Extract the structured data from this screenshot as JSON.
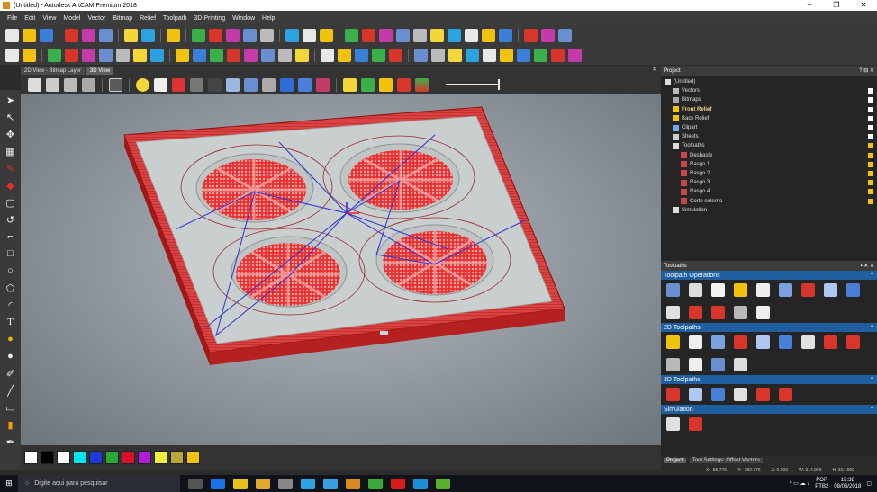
{
  "window": {
    "title": "(Untitled) - Autodesk ArtCAM Premium 2018",
    "controls": [
      "–",
      "❐",
      "✕"
    ]
  },
  "menu": [
    "File",
    "Edit",
    "View",
    "Model",
    "Vector",
    "Bitmap",
    "Relief",
    "Toolpath",
    "3D Printing",
    "Window",
    "Help"
  ],
  "colors": {
    "accent": "#1f5f9f",
    "toolpath_red": "#e02020",
    "toolpath_blue": "#2b34d4",
    "slab": "#c9cfcf",
    "frame": "#d42a2a"
  },
  "toolbar1_icons": [
    "new-icon",
    "open-icon",
    "save-icon",
    "sep",
    "cut-icon",
    "copy-icon",
    "paste-icon",
    "sep",
    "undo-icon",
    "redo-icon",
    "sep",
    "doc-icon",
    "sep",
    "crop-icon",
    "layers-icon",
    "grid-icon",
    "chart-icon",
    "wheel-icon",
    "sep",
    "eraser-icon",
    "diamond-icon",
    "nodes-icon",
    "sep",
    "folder-icon",
    "arrow-icon",
    "scissor-icon",
    "curve-icon",
    "star-icon",
    "green-diamond-icon",
    "stack-icon",
    "book-icon",
    "layer-stack-icon",
    "yellow-diamond-icon",
    "sep",
    "dots-icon",
    "grid-dots-icon",
    "wave-icon"
  ],
  "toolbar2_icons": [
    "search-icon",
    "flower-icon",
    "sep",
    "relief-blue-icon",
    "eraser-red-icon",
    "relief-1-icon",
    "relief-2-icon",
    "box-yellow-icon",
    "box-orange-icon",
    "box-ring-icon",
    "sep",
    "relief-3-icon",
    "relief-4-icon",
    "relief-5-icon",
    "relief-6-icon",
    "relief-7-icon",
    "relief-8-icon",
    "relief-9-icon",
    "relief-10-icon",
    "sep",
    "blue-1-icon",
    "blue-2-icon",
    "blue-3-icon",
    "bottle-icon",
    "layers-2-icon",
    "sep",
    "plus-green-icon",
    "cylinder-icon",
    "spiral-icon",
    "sweep-icon",
    "arch-icon",
    "magenta-icon",
    "ghost-1-icon",
    "ghost-2-icon",
    "ghost-3-icon",
    "target-icon"
  ],
  "view_tabs": [
    "2D View - Bitmap Layer",
    "3D View"
  ],
  "view_tab_close": "✕",
  "palette": [
    "#ffffff",
    "#000000",
    "#ffffff",
    "#00e5ee",
    "#1d3ad8",
    "#2aa836",
    "#d8102a",
    "#b01ad8",
    "#f2ee3a",
    "#b8a83a",
    "#f2c30c"
  ],
  "project_panel": {
    "title": "Project",
    "buttons": "? ⊟ ✕",
    "items": [
      {
        "label": "(Untitled)",
        "indent": 0,
        "icon": "file-icon",
        "bold": false
      },
      {
        "label": "Vectors",
        "indent": 1,
        "icon": "vector-icon",
        "bold": false
      },
      {
        "label": "Bitmaps",
        "indent": 1,
        "icon": "bitmap-icon",
        "bold": false
      },
      {
        "label": "Front Relief",
        "indent": 1,
        "icon": "star-icon",
        "bold": true
      },
      {
        "label": "Back Relief",
        "indent": 1,
        "icon": "star-icon",
        "bold": false
      },
      {
        "label": "Clipart",
        "indent": 1,
        "icon": "clipart-icon",
        "bold": false
      },
      {
        "label": "Sheets",
        "indent": 1,
        "icon": "sheet-icon",
        "bold": false
      },
      {
        "label": "Toolpaths",
        "indent": 1,
        "icon": "toolpath-icon",
        "bold": false
      },
      {
        "label": "Desbaste",
        "indent": 2,
        "icon": "toolpath-item-icon",
        "bold": false
      },
      {
        "label": "Rasgo 1",
        "indent": 2,
        "icon": "toolpath-item-icon",
        "bold": false
      },
      {
        "label": "Rasgo 2",
        "indent": 2,
        "icon": "toolpath-item-icon",
        "bold": false
      },
      {
        "label": "Rasgo 3",
        "indent": 2,
        "icon": "toolpath-item-icon",
        "bold": false
      },
      {
        "label": "Rasgo 4",
        "indent": 2,
        "icon": "toolpath-item-icon",
        "bold": false
      },
      {
        "label": "Corte externo",
        "indent": 2,
        "icon": "toolpath-item-icon",
        "bold": false
      },
      {
        "label": "Simulation",
        "indent": 1,
        "icon": "simulation-icon",
        "bold": false
      }
    ]
  },
  "toolpaths_panel": {
    "title": "Toolpaths",
    "buttons": "▪ ✕ ✕",
    "sections": [
      {
        "title": "Toolpath Operations",
        "icons": [
          "op-1-icon",
          "op-2-icon",
          "op-3-icon",
          "op-4-icon",
          "op-5-icon",
          "op-6-icon",
          "op-7-icon",
          "op-8-icon",
          "op-9-icon",
          "op-10-icon",
          "op-11-icon",
          "op-12-icon",
          "op-13-icon",
          "op-14-icon"
        ]
      },
      {
        "title": "2D Toolpaths",
        "icons": [
          "2d-1-icon",
          "2d-2-icon",
          "2d-3-icon",
          "2d-4-icon",
          "2d-5-icon",
          "2d-6-icon",
          "2d-7-icon",
          "2d-8-icon",
          "2d-9-icon",
          "2d-10-icon",
          "2d-11-icon",
          "2d-12-icon",
          "2d-13-icon"
        ]
      },
      {
        "title": "3D Toolpaths",
        "icons": [
          "3d-1-icon",
          "3d-2-icon",
          "3d-3-icon",
          "3d-4-icon",
          "3d-5-icon",
          "3d-6-icon"
        ]
      },
      {
        "title": "Simulation",
        "icons": [
          "sim-1-icon",
          "sim-2-icon"
        ]
      }
    ]
  },
  "panel_tabs": [
    "Project",
    "Tool Settings: Offset Vectors"
  ],
  "status": {
    "x": "X: -55.776",
    "y": "Y: -182.776",
    "z": "Z: 0.000",
    "w": "W: 314.969",
    "h": "H: 314.969"
  },
  "taskbar": {
    "search_placeholder": "Digite aqui para pesquisar",
    "lang": "POR",
    "lang2": "PTB2",
    "time": "15:38",
    "date": "08/06/2018"
  }
}
